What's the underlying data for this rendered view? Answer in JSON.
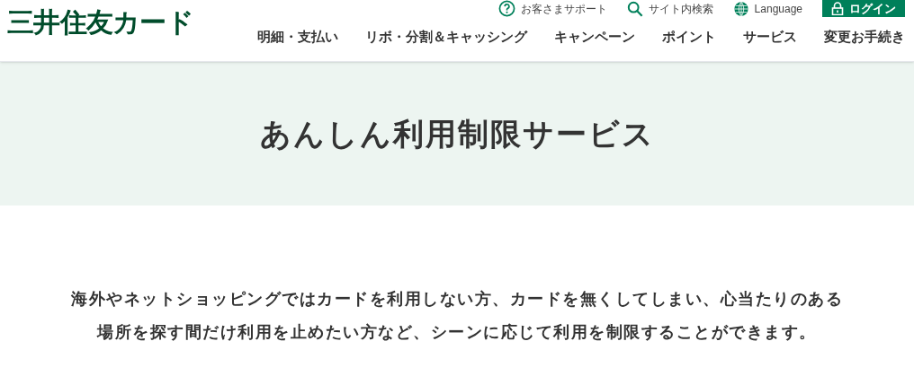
{
  "logo": "三井住友カード",
  "utility_links": [
    {
      "kind": "support",
      "label": "お客さまサポート"
    },
    {
      "kind": "search",
      "label": "サイト内検索"
    },
    {
      "kind": "language",
      "label": "Language"
    }
  ],
  "login_button": "ログイン",
  "nav": [
    "明細・支払い",
    "リボ・分割＆キャッシング",
    "キャンペーン",
    "ポイント",
    "サービス",
    "変更お手続き"
  ],
  "page_title": "あんしん利用制限サービス",
  "intro": "海外やネットショッピングではカードを利用しない方、カードを無くしてしまい、心当たりのある場所を探す間だけ利用を止めたい方など、シーンに応じて利用を制限することができます。"
}
